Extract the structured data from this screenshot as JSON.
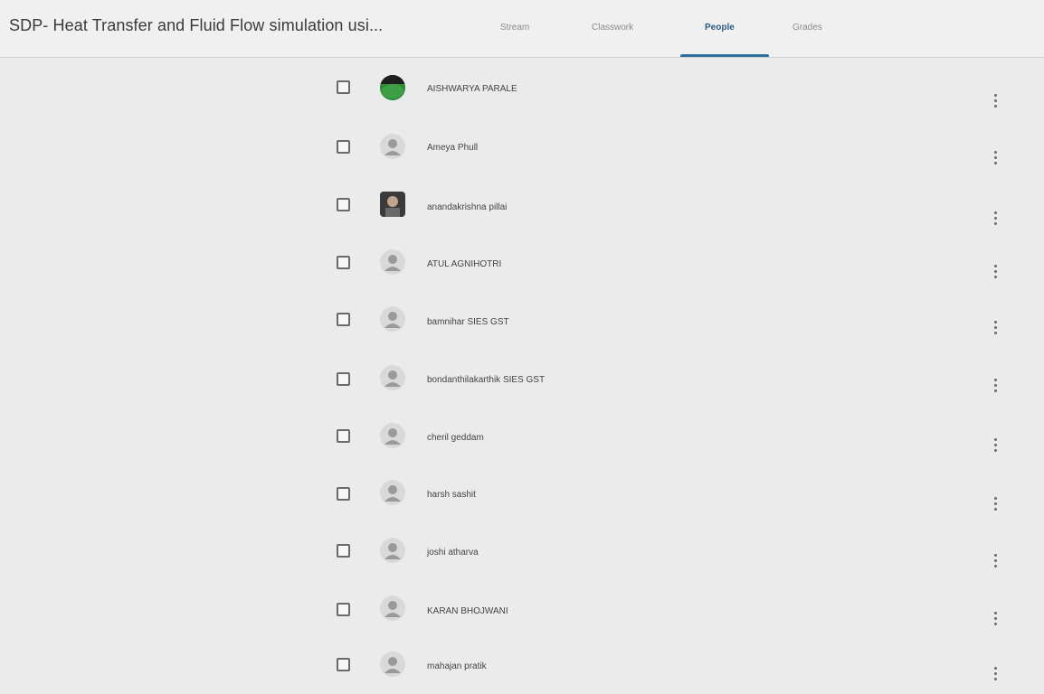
{
  "header": {
    "class_title": "SDP- Heat Transfer and Fluid Flow simulation usi...",
    "tabs": [
      {
        "label": "Stream",
        "active": false
      },
      {
        "label": "Classwork",
        "active": false
      },
      {
        "label": "People",
        "active": true
      },
      {
        "label": "Grades",
        "active": false
      }
    ],
    "accent_color": "#2a6fa0"
  },
  "people": [
    {
      "name": "AISHWARYA PARALE",
      "avatar": "green-photo"
    },
    {
      "name": "Ameya Phull",
      "avatar": "person-icon"
    },
    {
      "name": "anandakrishna pillai",
      "avatar": "photo"
    },
    {
      "name": "ATUL AGNIHOTRI",
      "avatar": "person-icon"
    },
    {
      "name": "bamnihar SIES GST",
      "avatar": "person-icon"
    },
    {
      "name": "bondanthilakarthik SIES GST",
      "avatar": "person-icon"
    },
    {
      "name": "cheril geddam",
      "avatar": "person-icon"
    },
    {
      "name": "harsh sashit",
      "avatar": "person-icon"
    },
    {
      "name": "joshi atharva",
      "avatar": "person-icon"
    },
    {
      "name": "KARAN BHOJWANI",
      "avatar": "person-icon"
    },
    {
      "name": "mahajan pratik",
      "avatar": "person-icon"
    }
  ]
}
